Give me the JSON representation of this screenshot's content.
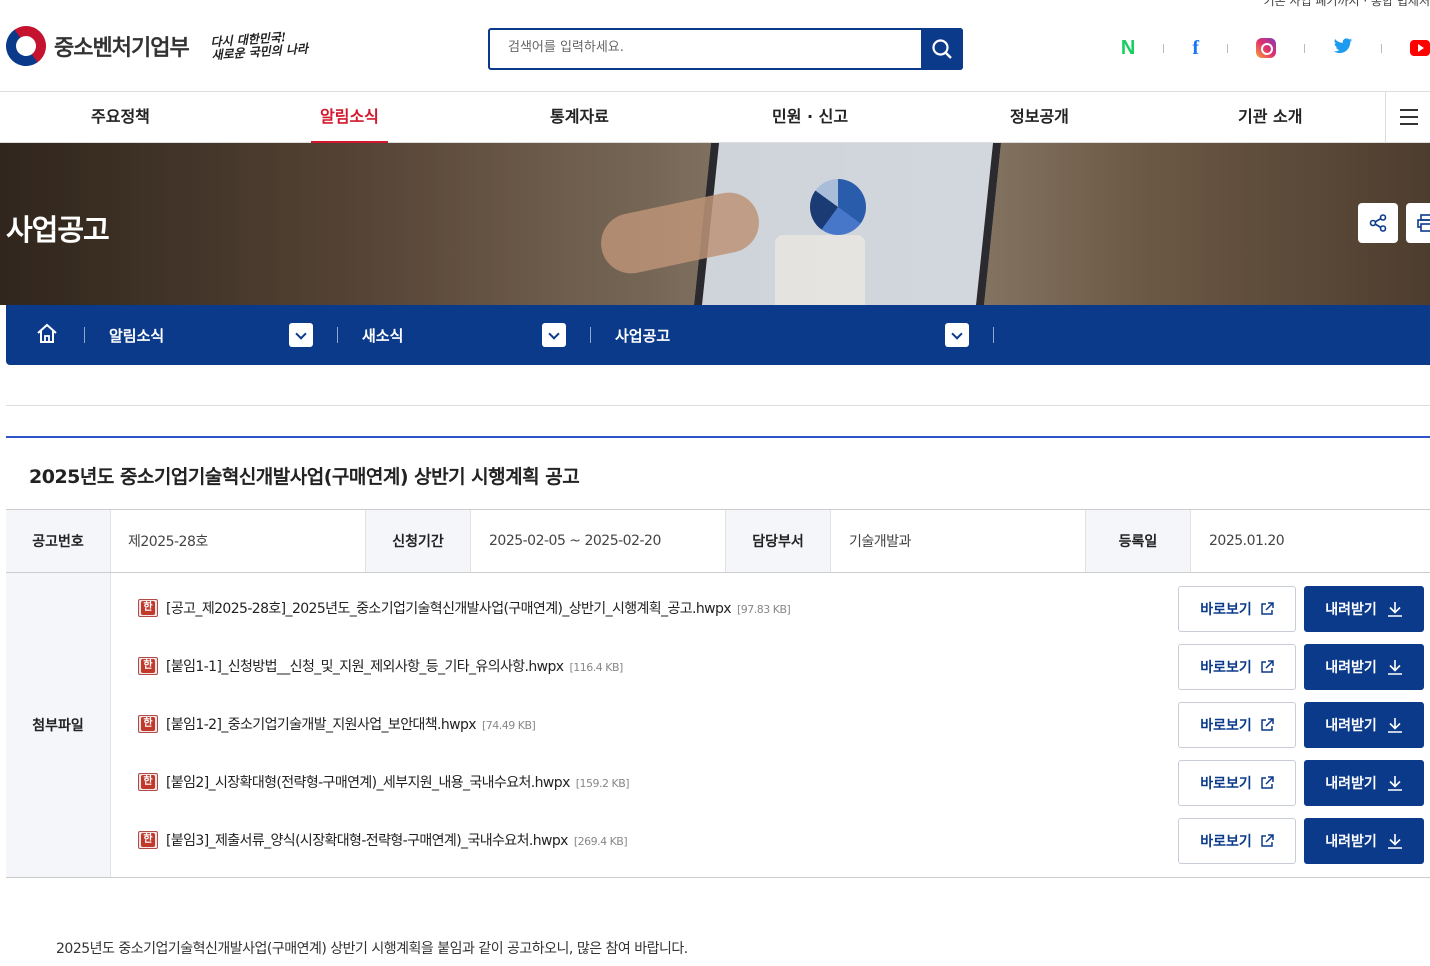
{
  "header": {
    "top_util": "기존 사업 폐기까지 · 통합 법제처",
    "logo_text": "중소벤처기업부",
    "slogan_line1": "다시 대한민국!",
    "slogan_line2": "새로운 국민의 나라",
    "search_placeholder": "검색어를 입력하세요.",
    "sns": [
      "naver-icon",
      "facebook-icon",
      "instagram-icon",
      "twitter-icon",
      "youtube-icon"
    ]
  },
  "gnb": {
    "items": [
      "주요정책",
      "알림소식",
      "통계자료",
      "민원 · 신고",
      "정보공개",
      "기관 소개"
    ],
    "active_index": 1
  },
  "hero": {
    "title": "사업공고"
  },
  "breadcrumb": {
    "level1": "알림소식",
    "level2": "새소식",
    "level3": "사업공고"
  },
  "post": {
    "title": "2025년도 중소기업기술혁신개발사업(구매연계) 상반기 시행계획 공고",
    "info": {
      "notice_no_label": "공고번호",
      "notice_no": "제2025-28호",
      "period_label": "신청기간",
      "period": "2025-02-05 ~ 2025-02-20",
      "dept_label": "담당부서",
      "dept": "기술개발과",
      "reg_label": "등록일",
      "reg_date": "2025.01.20"
    },
    "attach_label": "첨부파일",
    "view_label": "바로보기",
    "download_label": "내려받기",
    "files": [
      {
        "name": "[공고_제2025-28호]_2025년도_중소기업기술혁신개발사업(구매연계)_상반기_시행계획_공고.hwpx",
        "size": "[97.83 KB]"
      },
      {
        "name": "[붙임1-1]_신청방법__신청_및_지원_제외사항_등_기타_유의사항.hwpx",
        "size": "[116.4 KB]"
      },
      {
        "name": "[붙임1-2]_중소기업기술개발_지원사업_보안대책.hwpx",
        "size": "[74.49 KB]"
      },
      {
        "name": "[붙임2]_시장확대형(전략형-구매연계)_세부지원_내용_국내수요처.hwpx",
        "size": "[159.2 KB]"
      },
      {
        "name": "[붙임3]_제출서류_양식(시장확대형-전략형-구매연계)_국내수요처.hwpx",
        "size": "[269.4 KB]"
      }
    ],
    "body": "2025년도 중소기업기술혁신개발사업(구매연계) 상반기 시행계획을 붙임과 같이 공고하오니, 많은 참여 바랍니다."
  },
  "colors": {
    "primary": "#0b3a8b",
    "active": "#d1182c",
    "title_line": "#3052c8"
  }
}
